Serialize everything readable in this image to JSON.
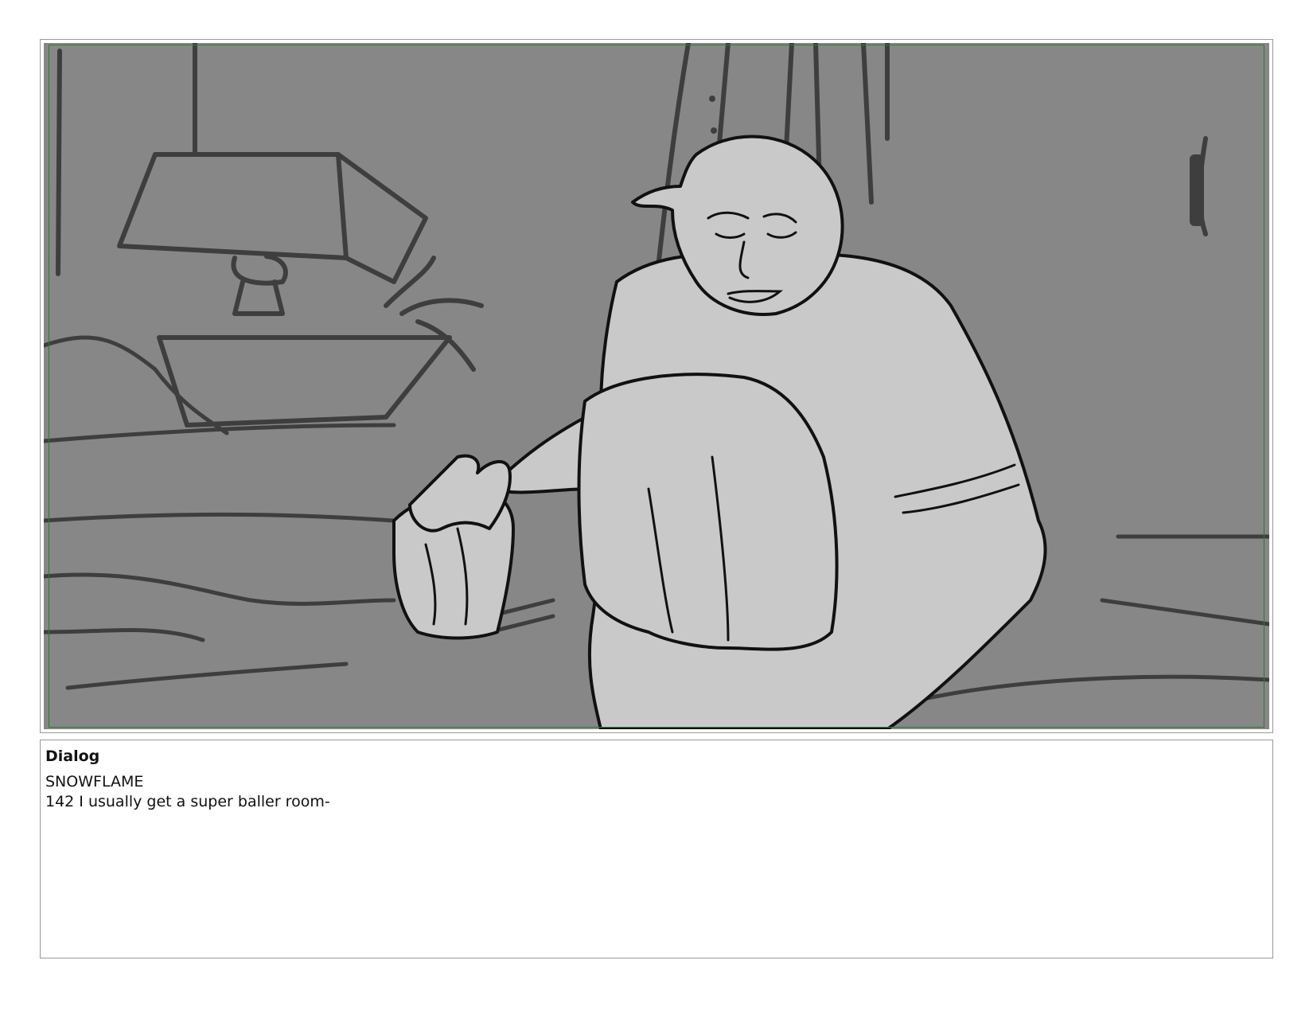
{
  "panel": {
    "image": "storyboard-sketch-character-sitting-on-bed-holding-cloth",
    "frame_color": "#2f7a2f",
    "background_color": "#878787"
  },
  "dialog": {
    "heading": "Dialog",
    "character": "SNOWFLAME",
    "line": "142 I usually get a super baller room-"
  }
}
